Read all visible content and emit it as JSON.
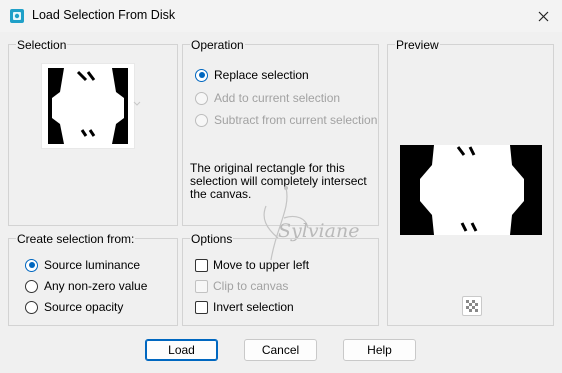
{
  "window": {
    "title": "Load Selection From Disk",
    "close_icon": "close-icon",
    "app_icon": "paint-shop-pro-icon"
  },
  "selection_group": {
    "label": "Selection",
    "thumbnail_icon": "selection-thumbnail",
    "dropdown_icon": "chevron-down-icon"
  },
  "operation_group": {
    "label": "Operation",
    "options": [
      {
        "label": "Replace selection",
        "checked": true,
        "enabled": true
      },
      {
        "label": "Add to current selection",
        "checked": false,
        "enabled": false
      },
      {
        "label": "Subtract from current selection",
        "checked": false,
        "enabled": false
      }
    ],
    "note": "The original rectangle for this selection will completely intersect the canvas."
  },
  "preview_group": {
    "label": "Preview",
    "zoom_icon": "checkerboard-icon"
  },
  "create_group": {
    "label": "Create selection from:",
    "options": [
      {
        "label": "Source luminance",
        "checked": true
      },
      {
        "label": "Any non-zero value",
        "checked": false
      },
      {
        "label": "Source opacity",
        "checked": false
      }
    ]
  },
  "options_group": {
    "label": "Options",
    "items": [
      {
        "label": "Move to upper left",
        "checked": false,
        "enabled": true
      },
      {
        "label": "Clip to canvas",
        "checked": false,
        "enabled": false
      },
      {
        "label": "Invert selection",
        "checked": false,
        "enabled": true
      }
    ]
  },
  "watermark": {
    "text": "Sylviane"
  },
  "buttons": {
    "load": "Load",
    "cancel": "Cancel",
    "help": "Help"
  },
  "colors": {
    "accent": "#0067c0",
    "background": "#f0f0f0",
    "border": "#d3d3d3"
  }
}
